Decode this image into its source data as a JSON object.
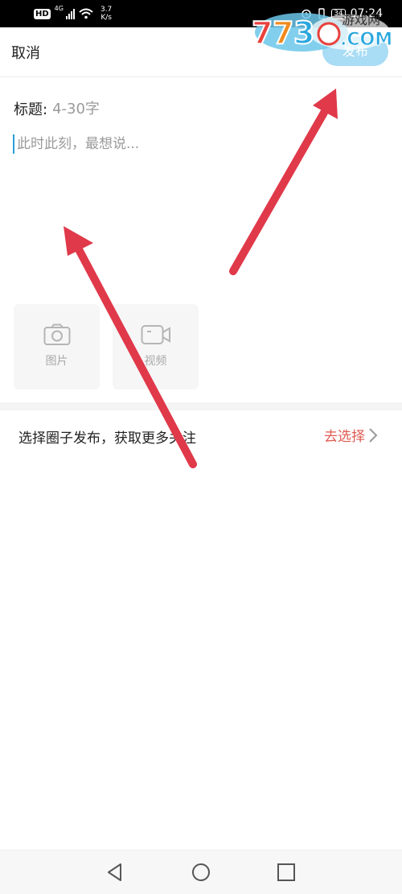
{
  "status_bar": {
    "hd": "HD",
    "network": "4G",
    "speed_value": "3.7",
    "speed_unit": "K/s",
    "battery": "34",
    "time": "07:24"
  },
  "header": {
    "cancel_label": "取消",
    "publish_label": "发布"
  },
  "watermark": {
    "logo_text": "7730.COM",
    "tag_text": "游戏网"
  },
  "form": {
    "title_label": "标题:",
    "title_placeholder": "4-30字",
    "content_placeholder": "此时此刻，最想说..."
  },
  "media": {
    "image_label": "图片",
    "video_label": "视频"
  },
  "circle": {
    "prompt": "选择圈子发布，获取更多关注",
    "action_label": "去选择"
  },
  "colors": {
    "accent_blue": "#a9dcf5",
    "action_red": "#e05a52",
    "annotation_arrow": "#e0394a"
  },
  "icons": [
    "back-icon",
    "home-icon",
    "recents-icon",
    "camera-icon",
    "video-camera-icon",
    "chevron-right-icon",
    "wifi-icon",
    "signal-icon"
  ]
}
